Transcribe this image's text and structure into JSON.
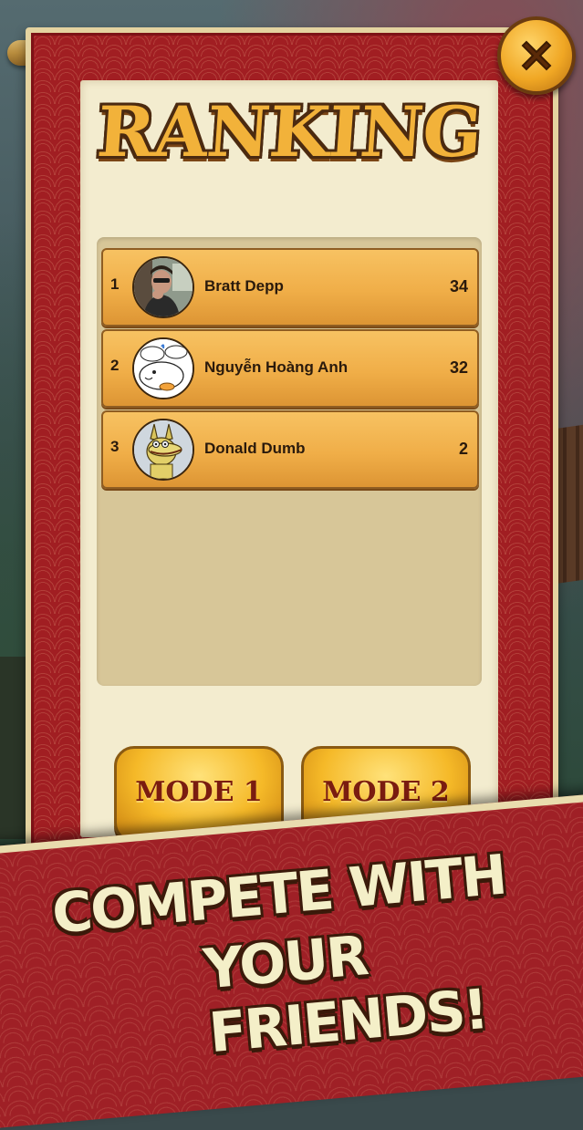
{
  "title": "RANKING",
  "rankings": [
    {
      "rank": "1",
      "name": "Bratt Depp",
      "score": "34",
      "avatar": "photo-avatar"
    },
    {
      "rank": "2",
      "name": "Nguyễn Hoàng Anh",
      "score": "32",
      "avatar": "cartoon-bird-avatar"
    },
    {
      "rank": "3",
      "name": "Donald Dumb",
      "score": "2",
      "avatar": "cartoon-creature-avatar"
    }
  ],
  "modes": [
    "MODE 1",
    "MODE 2"
  ],
  "promo": {
    "line1": "COMPETE WITH",
    "line2": "YOUR FRIENDS!"
  },
  "colors": {
    "scroll_red": "#a11e22",
    "paper": "#f3eccf",
    "row_gold": "#f0ae48",
    "title_gold": "#f2b23a"
  }
}
